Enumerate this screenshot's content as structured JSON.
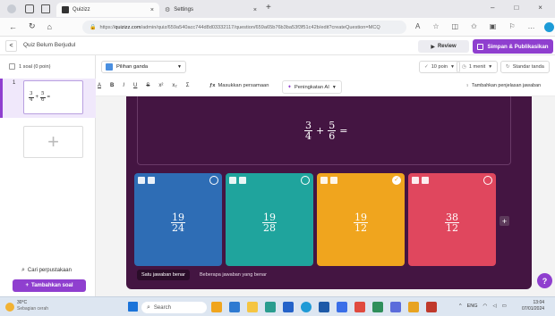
{
  "browser": {
    "tabs": [
      {
        "title": "Quizizz",
        "close": "×"
      },
      {
        "title": "Settings",
        "close": "×"
      }
    ],
    "new_tab": "+",
    "url_prefix": "https://",
    "url_domain": "quizizz.com",
    "url_path": "/admin/quiz/659a540acc744d8d03332117/question/659a65b76b3ba53f3f51c42b/edit?createQuestion=MCQ",
    "window_controls": [
      "–",
      "□",
      "×"
    ],
    "profile_initial": "A"
  },
  "header": {
    "back_label": "<",
    "quiz_title": "Quiz Belum Berjudul",
    "review_label": "Review",
    "publish_label": "Simpan & Publikasikan"
  },
  "sidebar": {
    "count_label": "1 soal (0 poin)",
    "slide_number": "1",
    "slide_preview_tail": "=",
    "add_slide": "+",
    "search_bank_label": "Cari perpustakaan",
    "add_question_label": "Tambahkan soal"
  },
  "toolbar": {
    "question_type": "Pilihan ganda",
    "points": "10 poin",
    "time": "1 menit",
    "grading": "Standar tanda",
    "format_buttons": [
      "A",
      "B",
      "I",
      "U",
      "S",
      "x²",
      "x₂",
      "Σ"
    ],
    "equation_label": "Masukkan persamaan",
    "ai_label": "Peningkatan AI",
    "explanation_label": "Tambahkan penjelasan jawaban"
  },
  "question": {
    "frac1": {
      "num": "3",
      "den": "4"
    },
    "operator": "+",
    "frac2": {
      "num": "5",
      "den": "6"
    },
    "equals": "="
  },
  "answers": [
    {
      "num": "19",
      "den": "24",
      "color": "#2e6db5",
      "correct": false
    },
    {
      "num": "19",
      "den": "28",
      "color": "#1fa49d",
      "correct": false
    },
    {
      "num": "19",
      "den": "12",
      "color": "#f0a51e",
      "correct": true
    },
    {
      "num": "38",
      "den": "12",
      "color": "#e0475e",
      "correct": false
    }
  ],
  "add_answer": "+",
  "modes": {
    "single": "Satu jawaban benar",
    "multiple": "Beberapa jawaban yang benar"
  },
  "help": "?",
  "taskbar": {
    "weather_temp": "30°C",
    "weather_text": "Sebagian cerah",
    "search_label": "Search",
    "lang": "ENG",
    "time": "13:04",
    "date": "07/01/2024"
  },
  "colors": {
    "brand": "#8f3fcf",
    "editor_bg": "#441542"
  }
}
